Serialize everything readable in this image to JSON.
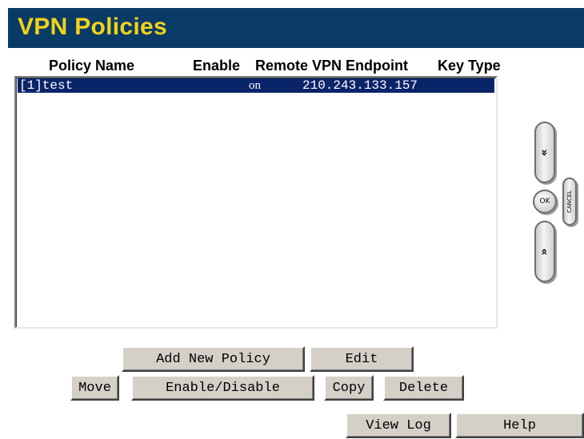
{
  "header": {
    "title": "VPN Policies"
  },
  "table": {
    "columns": [
      "Policy Name",
      "Enable",
      "Remote VPN Endpoint",
      "Key Type"
    ],
    "rows": [
      {
        "policy_name": "[1]test",
        "enable": "on",
        "remote_endpoint": "210.243.133.157",
        "key_type": ""
      }
    ]
  },
  "buttons": {
    "add_new_policy": "Add New Policy",
    "edit": "Edit",
    "move": "Move",
    "enable_disable": "Enable/Disable",
    "copy": "Copy",
    "delete": "Delete",
    "view_log": "View Log",
    "help": "Help"
  },
  "nav": {
    "up_icon": "double-chevron-up-icon",
    "down_icon": "double-chevron-down-icon",
    "up": "«",
    "down": "»",
    "ok": "OK",
    "cancel": "CANCEL"
  }
}
